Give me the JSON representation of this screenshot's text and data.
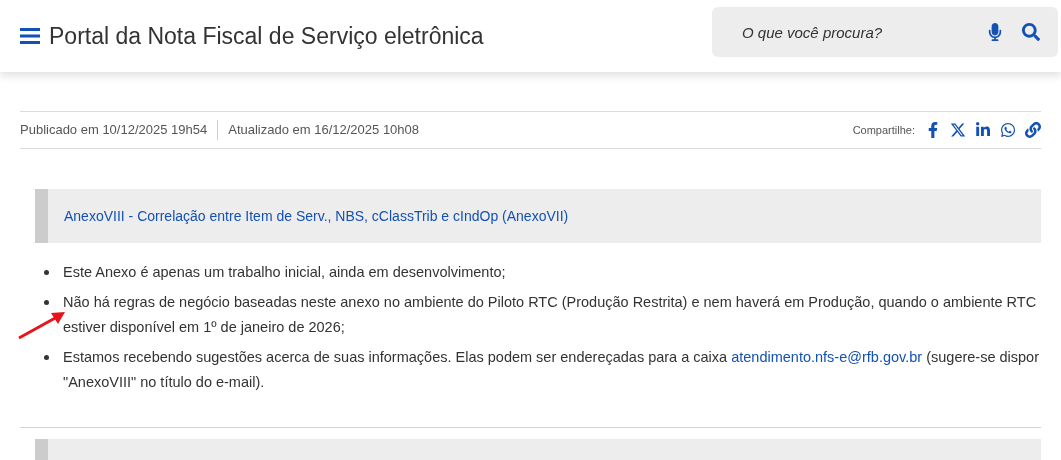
{
  "header": {
    "title": "Portal da Nota Fiscal de Serviço eletrônica",
    "search": {
      "placeholder": "O que você procura?"
    }
  },
  "article": {
    "published": "Publicado em 10/12/2025 19h54",
    "updated": "Atualizado em 16/12/2025 10h08",
    "share_label": "Compartilhe:"
  },
  "attachment": {
    "link": "AnexoVIII - Correlação entre Item de Serv., NBS, cClassTrib e cIndOp (AnexoVII)"
  },
  "bullets": [
    {
      "text": "Este Anexo é apenas um trabalho inicial, ainda em desenvolvimento;"
    },
    {
      "text": "Não há regras de negócio baseadas neste anexo no ambiente do Piloto RTC (Produção Restrita) e nem haverá em Produção, quando o ambiente RTC estiver disponível em 1º de janeiro de 2026;"
    },
    {
      "text": "Estamos recebendo sugestões acerca de suas informações. Elas podem ser endereçadas para a caixa ",
      "link": "atendimento.nfs-e@rfb.gov.br",
      "after": " (sugere-se dispor \"AnexoVIII\" no título do e-mail)."
    }
  ]
}
